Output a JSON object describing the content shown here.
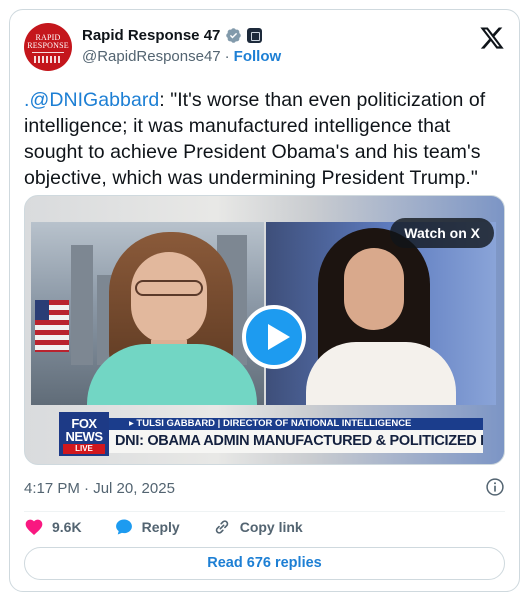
{
  "author": {
    "display_name": "Rapid Response 47",
    "handle": "@RapidResponse47",
    "separator": "·",
    "follow_label": "Follow",
    "avatar_text_top": "RAPID",
    "avatar_text_bottom": "RESPONSE"
  },
  "tweet": {
    "mention": ".@DNIGabbard",
    "body": ": \"It's worse than even politicization of intelligence; it was manufactured intelligence that sought to achieve President Obama's and his team's objective, which was undermining President Trump.\""
  },
  "media": {
    "watch_label": "Watch on X",
    "chyron_top": "▸ TULSI GABBARD | DIRECTOR OF NATIONAL INTELLIGENCE",
    "chyron_main": "DNI: OBAMA ADMIN MANUFACTURED & POLITICIZED INTEL",
    "network_line1": "FOX",
    "network_line2": "NEWS",
    "network_live": "LIVE"
  },
  "meta": {
    "timestamp": "4:17 PM · Jul 20, 2025"
  },
  "actions": {
    "like_count": "9.6K",
    "reply_label": "Reply",
    "copy_link_label": "Copy link"
  },
  "replies_button": "Read 676 replies",
  "colors": {
    "link_blue": "#1d7fd4",
    "like_pink": "#f91880",
    "reply_blue": "#1d9bf0",
    "avatar_red": "#c4161c"
  }
}
